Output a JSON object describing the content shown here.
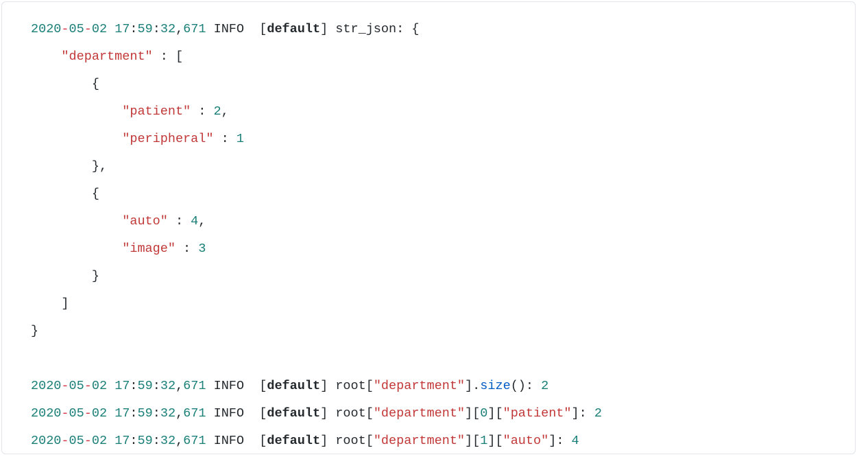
{
  "log": {
    "date_year": "2020",
    "dash": "-",
    "date_month": "05",
    "date_day": "02",
    "time_h": "17",
    "colon": ":",
    "time_m": "59",
    "time_s": "32",
    "comma": ",",
    "ms": "671",
    "level": "INFO",
    "lbracket": "[",
    "rbracket": "]",
    "facility": "default",
    "msg_str_json": "str_json",
    "msg_root": "root",
    "size_fn": "size",
    "parens": "()",
    "sep": ": "
  },
  "json": {
    "key_department": "\"department\"",
    "key_patient": "\"patient\"",
    "key_peripheral": "\"peripheral\"",
    "key_auto": "\"auto\"",
    "key_image": "\"image\"",
    "idx0": "0",
    "idx1": "1",
    "v_patient": "2",
    "v_peripheral": "1",
    "v_auto": "4",
    "v_image": "3",
    "size_val": "2",
    "patient_val_out": "2",
    "auto_val_out": "4"
  },
  "punct": {
    "lbrace": "{",
    "rbrace": "}",
    "lbrack": "[",
    "rbrack": "]",
    "comma": ",",
    "space_colon_space": " : ",
    "dot": "."
  }
}
